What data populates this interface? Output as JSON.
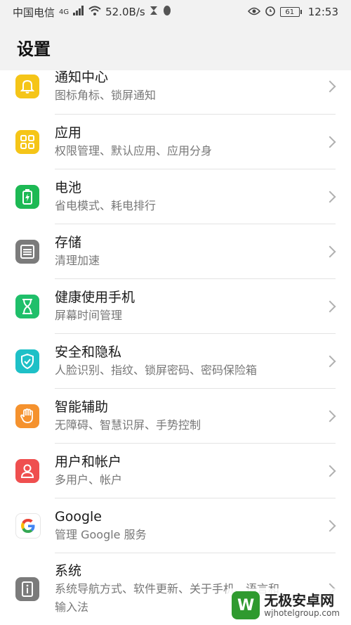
{
  "status_bar": {
    "carrier": "中国电信",
    "network": "4G",
    "speed": "52.0B/s",
    "battery": "61",
    "time": "12:53"
  },
  "header": {
    "title": "设置"
  },
  "items": [
    {
      "title": "通知中心",
      "subtitle": "图标角标、锁屏通知",
      "icon": "bell-icon",
      "color": "#f5c518"
    },
    {
      "title": "应用",
      "subtitle": "权限管理、默认应用、应用分身",
      "icon": "apps-grid-icon",
      "color": "#f5c518"
    },
    {
      "title": "电池",
      "subtitle": "省电模式、耗电排行",
      "icon": "battery-icon",
      "color": "#1db954"
    },
    {
      "title": "存储",
      "subtitle": "清理加速",
      "icon": "storage-icon",
      "color": "#7b7b7b"
    },
    {
      "title": "健康使用手机",
      "subtitle": "屏幕时间管理",
      "icon": "hourglass-icon",
      "color": "#1fbf6a"
    },
    {
      "title": "安全和隐私",
      "subtitle": "人脸识别、指纹、锁屏密码、密码保险箱",
      "icon": "shield-icon",
      "color": "#1ec0c7"
    },
    {
      "title": "智能辅助",
      "subtitle": "无障碍、智慧识屏、手势控制",
      "icon": "hand-icon",
      "color": "#f5922e"
    },
    {
      "title": "用户和帐户",
      "subtitle": "多用户、帐户",
      "icon": "user-icon",
      "color": "#ef4f4f"
    },
    {
      "title": "Google",
      "subtitle": "管理 Google 服务",
      "icon": "google-icon",
      "color": "#ffffff"
    },
    {
      "title": "系统",
      "subtitle": "系统导航方式、软件更新、关于手机、语言和",
      "subtitle2": "输入法",
      "icon": "system-info-icon",
      "color": "#7b7b7b"
    }
  ],
  "watermark": {
    "name": "无极安卓网",
    "url": "wjhotelgroup.com"
  }
}
